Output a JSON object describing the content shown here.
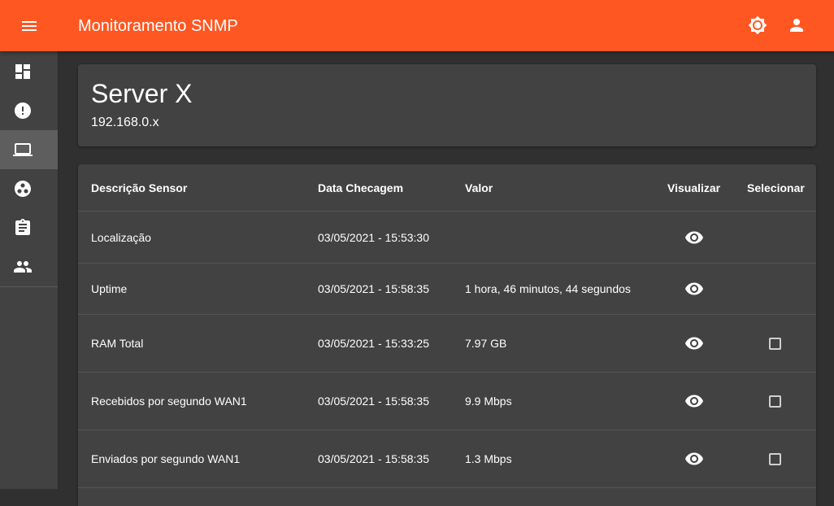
{
  "app": {
    "title": "Monitoramento SNMP"
  },
  "colors": {
    "primary": "#ff5722",
    "background": "#303030",
    "surface": "#424242",
    "sidebar_active": "#5e5e5e"
  },
  "topbar": {
    "menu_icon": "menu-icon",
    "theme_icon": "brightness-icon",
    "account_icon": "account-icon"
  },
  "sidebar": {
    "items": [
      {
        "icon": "dashboard-icon",
        "active": false
      },
      {
        "icon": "alert-icon",
        "active": false
      },
      {
        "icon": "laptop-icon",
        "active": true
      },
      {
        "icon": "group-work-icon",
        "active": false
      },
      {
        "icon": "clipboard-icon",
        "active": false
      },
      {
        "icon": "people-icon",
        "active": false
      }
    ]
  },
  "server": {
    "name": "Server X",
    "ip": "192.168.0.x"
  },
  "table": {
    "headers": {
      "description": "Descrição Sensor",
      "date": "Data Checagem",
      "value": "Valor",
      "view": "Visualizar",
      "select": "Selecionar"
    },
    "rows": [
      {
        "description": "Localização",
        "date": "03/05/2021 - 15:53:30",
        "value": "",
        "selectable": false
      },
      {
        "description": "Uptime",
        "date": "03/05/2021 - 15:58:35",
        "value": "1 hora, 46 minutos, 44 segundos",
        "selectable": false
      },
      {
        "description": "RAM Total",
        "date": "03/05/2021 - 15:33:25",
        "value": "7.97 GB",
        "selectable": true
      },
      {
        "description": "Recebidos por segundo WAN1",
        "date": "03/05/2021 - 15:58:35",
        "value": "9.9 Mbps",
        "selectable": true
      },
      {
        "description": "Enviados por segundo WAN1",
        "date": "03/05/2021 - 15:58:35",
        "value": "1.3 Mbps",
        "selectable": true
      }
    ]
  }
}
